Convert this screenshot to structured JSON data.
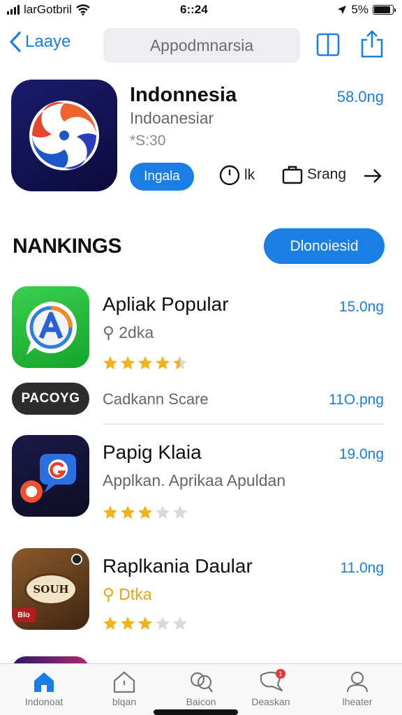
{
  "status_bar": {
    "carrier": "larGotbril",
    "time": "6::24",
    "battery_text": "5%",
    "battery_level": 0.9
  },
  "nav": {
    "back_label": "Laaye",
    "search_text": "Appodmnarsia",
    "icons": [
      "back-chevron-icon",
      "reader-icon",
      "share-icon"
    ]
  },
  "hero": {
    "title": "Indonnesia",
    "subtitle": "Indoanesiar",
    "rating_text": "*S:30",
    "price": "58.0ng",
    "get_label": "Ingala",
    "time_label": "lk",
    "bag_label": "Srang"
  },
  "section": {
    "title": "NANKINGS",
    "button_label": "Dlonoiesid"
  },
  "apps": [
    {
      "title": "Apliak Popular",
      "subtitle": "2dka",
      "price": "15.0ng",
      "rating": 4.5,
      "icon": "chat-a-icon"
    },
    {
      "title": "Papig Klaia",
      "subtitle": "Applkan. Aprikaa Apuldan",
      "price": "19.0ng",
      "rating": 3,
      "icon": "chat-g-icon"
    },
    {
      "title": "Raplkania Daular",
      "subtitle": "Dtka",
      "price": "11.0ng",
      "rating": 3,
      "icon": "food-photo-icon"
    }
  ],
  "promo": {
    "logo_text": "PACOYG",
    "text": "Cadkann Scare",
    "price": "11O.png"
  },
  "food_icon_text": {
    "main": "SOUH",
    "corner": "Blo"
  },
  "tabs": [
    {
      "label": "Indonoat",
      "icon": "home-icon",
      "active": true
    },
    {
      "label": "blqan",
      "icon": "house-outline-icon",
      "active": false
    },
    {
      "label": "Baicon",
      "icon": "search-people-icon",
      "active": false
    },
    {
      "label": "Deaskan",
      "icon": "chat-bubble-icon",
      "active": false,
      "badge": "1"
    },
    {
      "label": "lheater",
      "icon": "person-icon",
      "active": false
    }
  ],
  "colors": {
    "accent": "#1a7ee6",
    "star": "#f2b21b",
    "star_empty": "#d9d9d9"
  }
}
